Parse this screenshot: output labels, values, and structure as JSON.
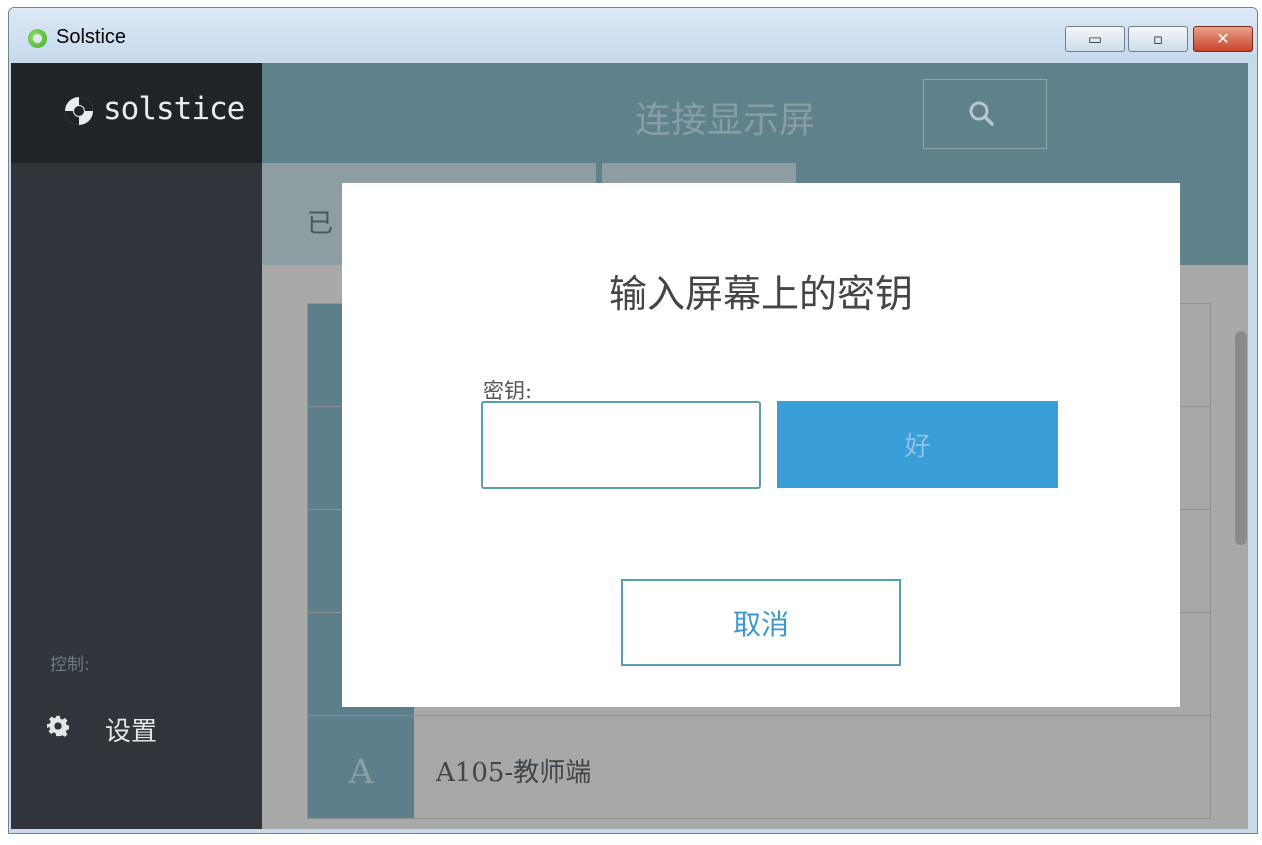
{
  "window": {
    "title": "Solstice",
    "controls": {
      "minimize": "▭",
      "maximize": "▫",
      "close": "✕"
    }
  },
  "sidebar": {
    "logo_text": "solstice",
    "control_label": "控制:",
    "settings_label": "设置",
    "icons": {
      "logo": "solstice-logo-icon",
      "settings": "gear-icon"
    }
  },
  "header": {
    "title": "连接显示屏",
    "search_icon": "search-icon",
    "tab_label_partial": "已"
  },
  "list": {
    "rows": [
      {
        "letter": "",
        "name": ""
      },
      {
        "letter": "",
        "name": ""
      },
      {
        "letter": "",
        "name": ""
      },
      {
        "letter": "",
        "name": ""
      },
      {
        "letter": "A",
        "name": "A105-教师端"
      }
    ]
  },
  "dialog": {
    "title": "输入屏幕上的密钥",
    "key_label": "密钥:",
    "key_value": "",
    "ok_label": "好",
    "cancel_label": "取消"
  },
  "colors": {
    "header": "#5f818c",
    "sidebar": "#2f353b",
    "accent": "#3a9fd9",
    "border_accent": "#5b9eb0"
  }
}
